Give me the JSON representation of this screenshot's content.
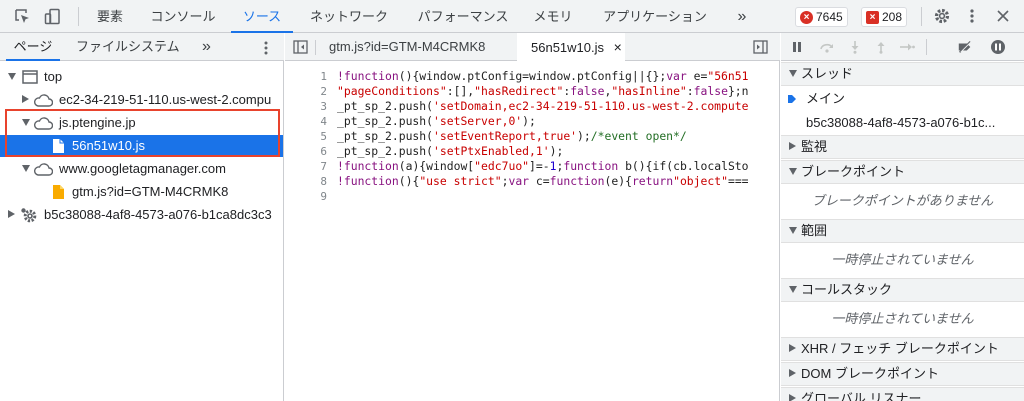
{
  "toolbar": {
    "tabs": [
      "要素",
      "コンソール",
      "ソース",
      "ネットワーク",
      "パフォーマンス",
      "メモリ",
      "アプリケーション"
    ],
    "more_tabs": "»",
    "error_count": "7645",
    "issue_count": "208"
  },
  "navigator": {
    "tabs": [
      "ページ",
      "ファイルシステム"
    ],
    "more": "»",
    "tree": [
      {
        "label": "top"
      },
      {
        "label": "ec2-34-219-51-110.us-west-2.compu"
      },
      {
        "label": "js.ptengine.jp"
      },
      {
        "label": "56n51w10.js"
      },
      {
        "label": "www.googletagmanager.com"
      },
      {
        "label": "gtm.js?id=GTM-M4CRMK8"
      },
      {
        "label": "b5c38088-4af8-4573-a076-b1ca8dc3c3"
      }
    ]
  },
  "editor": {
    "tabs": [
      {
        "label": "gtm.js?id=GTM-M4CRMK8"
      },
      {
        "label": "56n51w10.js",
        "close": "×"
      }
    ],
    "line_numbers": [
      "1",
      "2",
      "3",
      "4",
      "5",
      "6",
      "7",
      "8",
      "9"
    ],
    "lines": [
      [
        [
          "k",
          "!function"
        ],
        [
          "p",
          "(){window.ptConfig=window.ptConfig||{};"
        ],
        [
          "k",
          "var"
        ],
        [
          "p",
          " e="
        ],
        [
          "s",
          "\"56n51"
        ]
      ],
      [
        [
          "s",
          "\"pageConditions\""
        ],
        [
          "p",
          ":[],"
        ],
        [
          "s",
          "\"hasRedirect\""
        ],
        [
          "p",
          ":"
        ],
        [
          "k",
          "false"
        ],
        [
          "p",
          ","
        ],
        [
          "s",
          "\"hasInline\""
        ],
        [
          "p",
          ":"
        ],
        [
          "k",
          "false"
        ],
        [
          "p",
          "};n"
        ]
      ],
      [
        [
          "p",
          "_pt_sp_2.push("
        ],
        [
          "s",
          "'setDomain,ec2-34-219-51-110.us-west-2.compute"
        ]
      ],
      [
        [
          "p",
          "_pt_sp_2.push("
        ],
        [
          "s",
          "'setServer,0'"
        ],
        [
          "p",
          ");"
        ]
      ],
      [
        [
          "p",
          "_pt_sp_2.push("
        ],
        [
          "s",
          "'setEventReport,true'"
        ],
        [
          "p",
          ");"
        ],
        [
          "c",
          "/*event open*/"
        ]
      ],
      [
        [
          "p",
          "_pt_sp_2.push("
        ],
        [
          "s",
          "'setPtxEnabled,1'"
        ],
        [
          "p",
          ");"
        ]
      ],
      [
        [
          "k",
          "!function"
        ],
        [
          "p",
          "(a){window["
        ],
        [
          "s",
          "\"edc7uo\""
        ],
        [
          "p",
          "]=-"
        ],
        [
          "n",
          "1"
        ],
        [
          "p",
          ";"
        ],
        [
          "k",
          "function"
        ],
        [
          "p",
          " b(){if(cb.localSto"
        ]
      ],
      [
        [
          "k",
          "!function"
        ],
        [
          "p",
          "(){"
        ],
        [
          "s",
          "\"use strict\""
        ],
        [
          "p",
          ";"
        ],
        [
          "k",
          "var"
        ],
        [
          "p",
          " c="
        ],
        [
          "k",
          "function"
        ],
        [
          "p",
          "(e){"
        ],
        [
          "k",
          "return"
        ],
        [
          "s",
          "\"object\""
        ],
        [
          "p",
          "==="
        ]
      ],
      []
    ]
  },
  "debugger": {
    "threads_label": "スレッド",
    "main_thread": "メイン",
    "worker_thread": "b5c38088-4af8-4573-a076-b1c...",
    "watch_label": "監視",
    "breakpoints_label": "ブレークポイント",
    "no_breakpoints": "ブレークポイントがありません",
    "scope_label": "範囲",
    "scope_empty": "一時停止されていません",
    "callstack_label": "コールスタック",
    "callstack_empty": "一時停止されていません",
    "xhr_label": "XHR / フェッチ ブレークポイント",
    "dom_label": "DOM ブレークポイント",
    "global_label": "グローバル リスナー"
  }
}
